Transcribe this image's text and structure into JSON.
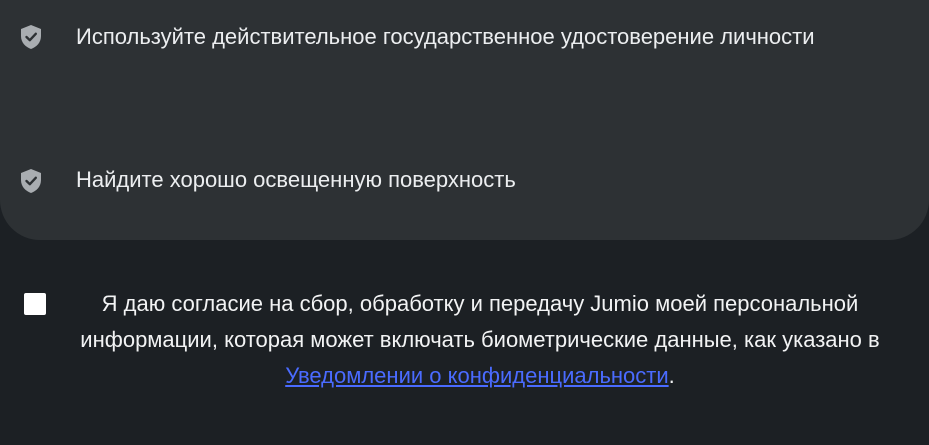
{
  "tips": [
    {
      "icon": "shield-check-icon",
      "text": "Используйте действительное государственное удостоверение личности"
    },
    {
      "icon": "shield-check-icon",
      "text": "Найдите хорошо освещенную поверхность"
    }
  ],
  "consent": {
    "checked": false,
    "text_before": "Я даю согласие на сбор, обработку и передачу Jumio моей персональной информации, которая может включать биометрические данные, как указано в ",
    "link_label": "Уведомлении о конфиденциальности",
    "text_after": "."
  },
  "colors": {
    "background": "#1c2024",
    "card": "#2d3134",
    "link": "#4a6bff",
    "icon": "#a9adb1"
  }
}
